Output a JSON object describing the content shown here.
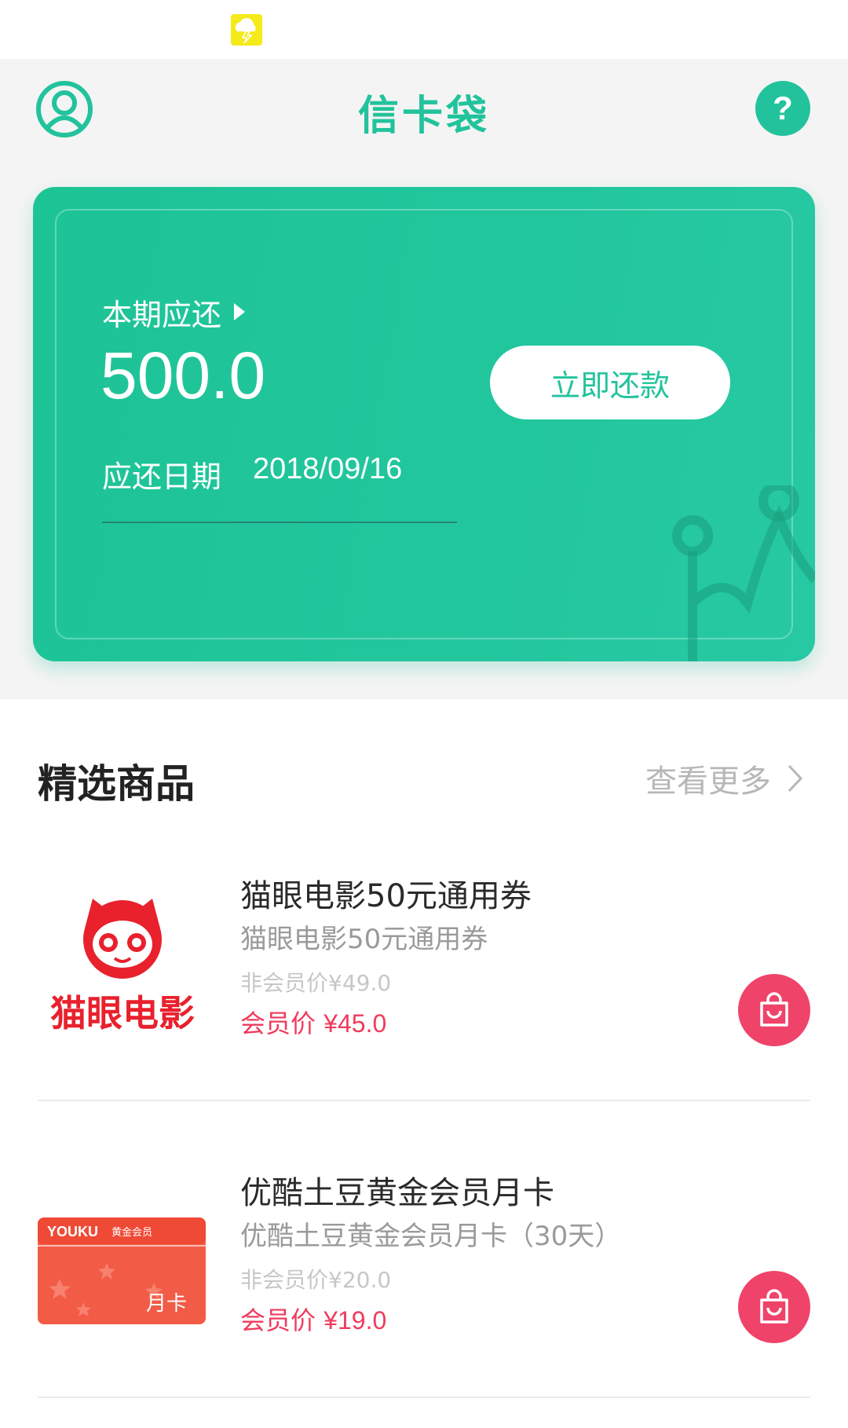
{
  "status_bar": {
    "notification_icon": "weather-thunder-icon",
    "icon_color": "#f5ea1a"
  },
  "header": {
    "title": "信卡袋",
    "left_icon": "user-avatar-icon",
    "right_icon": "help-icon",
    "accent_color": "#22c39c"
  },
  "bill_card": {
    "period_label": "本期应还",
    "amount": "500.0",
    "due_label": "应还日期",
    "due_date": "2018/09/16",
    "repay_button_label": "立即还款",
    "background_color": "#22c49c"
  },
  "featured": {
    "title": "精选商品",
    "see_more_label": "查看更多"
  },
  "products": [
    {
      "image_icon": "maoyan-logo",
      "logo_text": "猫眼电影",
      "name": "猫眼电影50元通用券",
      "subtitle": "猫眼电影50元通用券",
      "original_price": "非会员价¥49.0",
      "member_label": "会员价",
      "member_price": "¥45.0",
      "cart_icon": "shopping-bag-icon"
    },
    {
      "image_icon": "youku-gold-card",
      "logo_text": "YOUKU",
      "card_badge": "黄金会员",
      "card_label": "月卡",
      "name": "优酷土豆黄金会员月卡",
      "subtitle": "优酷土豆黄金会员月卡（30天）",
      "original_price": "非会员价¥20.0",
      "member_label": "会员价",
      "member_price": "¥19.0",
      "cart_icon": "shopping-bag-icon"
    }
  ],
  "colors": {
    "price_red": "#ef3b5d",
    "cart_pink": "#f0436a",
    "muted_gray": "#b7b7b7"
  }
}
